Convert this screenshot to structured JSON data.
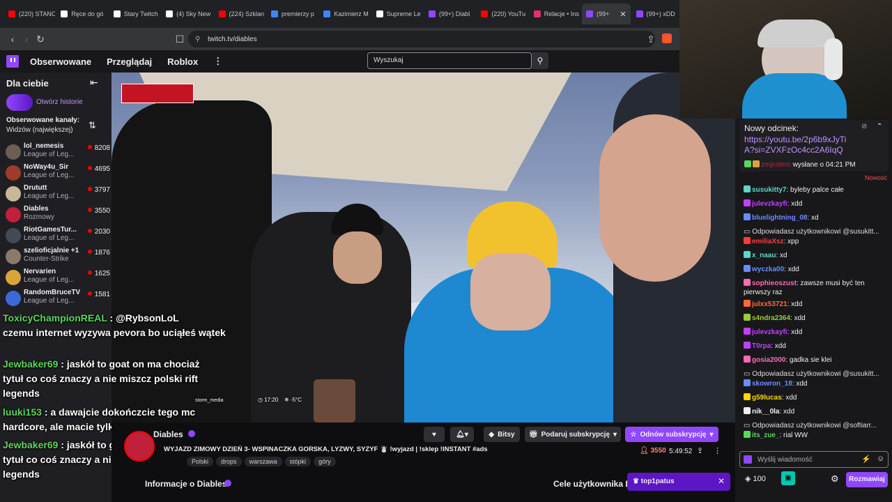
{
  "browser": {
    "tabs": [
      "(220) STANO",
      "Ręce do gó",
      "Stary Twitch",
      "(4) Sky New",
      "(224) Szklan",
      "premierzy p",
      "Kazimierz M",
      "Supreme Le",
      "(99+) Diabl",
      "(220) YouTu",
      "Relacje • Ins",
      "(99+",
      "(99+) xDD"
    ],
    "tab_colors": [
      "#ff0000",
      "#ffffff",
      "#ffffff",
      "#ffffff",
      "#ff0000",
      "#4285f4",
      "#4285f4",
      "#ffffff",
      "#9147ff",
      "#ff0000",
      "#e1306c",
      "#9147ff",
      "#9147ff"
    ],
    "url": "twitch.tv/diables"
  },
  "nav": {
    "links": [
      "Obserwowane",
      "Przeglądaj",
      "Roblox"
    ],
    "more": "⋮",
    "search_placeholder": "Wyszukaj"
  },
  "sidebar": {
    "title": "Dla ciebie",
    "stories_link": "Otwórz historie",
    "followed_title": "Obserwowane kanały:",
    "followed_sort": "Widzów (największej)",
    "channels": [
      {
        "name": "lol_nemesis",
        "game": "League of Leg...",
        "viewers": "8208",
        "color": "#6b5f55"
      },
      {
        "name": "NoWay4u_Sir",
        "game": "League of Leg...",
        "viewers": "4695",
        "color": "#a03a2a"
      },
      {
        "name": "Drututt",
        "game": "League of Leg...",
        "viewers": "3797",
        "color": "#c9b79a"
      },
      {
        "name": "Diables",
        "game": "Rozmowy",
        "viewers": "3550",
        "color": "#c0203a"
      },
      {
        "name": "RiotGamesTur...",
        "game": "League of Leg...",
        "viewers": "2030",
        "color": "#444a55"
      },
      {
        "name": "szelioficjalnie +1",
        "game": "Counter-Strike",
        "viewers": "1876",
        "color": "#8a7a6a"
      },
      {
        "name": "Nervarien",
        "game": "League of Leg...",
        "viewers": "1625",
        "color": "#d9a43a"
      },
      {
        "name": "RandomBruceTV",
        "game": "League of Leg...",
        "viewers": "1581",
        "color": "#3a6ad9"
      }
    ]
  },
  "video_overlay": {
    "lines": [
      {
        "user": "ToxicyChampionREAL",
        "text": " : @RybsonLoL"
      },
      {
        "user": "",
        "text": "czemu internet wyzywa pevora bo uciąłeś wątek"
      },
      {
        "user": "Jewbaker69",
        "text": " : jaskół to goat on ma chociaż"
      },
      {
        "user": "",
        "text": "tytuł co coś znaczy a nie miszcz polski rift"
      },
      {
        "user": "",
        "text": "legends"
      },
      {
        "user": "luuki153",
        "text": " : a dawajcie dokończcie tego mc"
      },
      {
        "user": "",
        "text": "hardcore, ale macie tylko jedno podejście"
      },
      {
        "user": "Jewbaker69",
        "text": " : jaskół to goat on ma chociaż"
      },
      {
        "user": "",
        "text": "tytuł co coś znaczy a nie miszcz polski rift"
      },
      {
        "user": "",
        "text": "legends"
      }
    ],
    "storm": "storm_media",
    "time": "17:20",
    "temp": "-5°C"
  },
  "stream_info": {
    "channel": "Diables",
    "title": "WYJAZD ZIMOWY DZIEŃ 3- WSPINACZKA GORSKA, LYZWY, SYZYF ☃️ !wyjazd | !sklep !INSTANT #ads",
    "tags": [
      "Polski",
      "drops",
      "warszawa",
      "stópki",
      "góry"
    ],
    "viewers": "3550",
    "uptime": "5:49:52",
    "bits_label": "Bitsy",
    "gift_label": "Podaruj subskrypcję",
    "renew_label": "Odnów subskrypcję",
    "about": "Informacje o Diables",
    "goals": "Cele użytkownika D",
    "toast_user": "top1patus"
  },
  "chat": {
    "pinned_title": "Nowy odcinek:",
    "pinned_link": "https://youtu.be/2p6b9xJyTiA?si=ZVXFzOc4cc2A6IqQ",
    "pinned_by": "zmjestem",
    "pinned_sent": "wysłane o 04:21 PM",
    "new_label": "Nowość",
    "messages": [
      {
        "user": "susukitty7",
        "color": "#5ad8c8",
        "text": ": byleby palce całe"
      },
      {
        "user": "julevzkayfi",
        "color": "#c040ff",
        "text": ": xdd"
      },
      {
        "user": "bluelightning_08",
        "color": "#6a8cff",
        "text": ": xd"
      },
      {
        "reply": "Odpowiadasz użytkownikowi @susukitt..."
      },
      {
        "user": "emiliaXsz",
        "color": "#ff3b3b",
        "text": ": xpp"
      },
      {
        "user": "x_naau",
        "color": "#5ad8c8",
        "text": ": xd"
      },
      {
        "user": "wyczka00",
        "color": "#6a8cff",
        "text": ": xdd"
      },
      {
        "user": "sophieoszust",
        "color": "#ff69b4",
        "text": ": zawsze musi być ten pierwszy raz"
      },
      {
        "user": "julxx53721",
        "color": "#ff6a3a",
        "text": ": xdd"
      },
      {
        "user": "s4ndra2364",
        "color": "#9acd32",
        "text": ": xdd"
      },
      {
        "user": "julevzkayfi",
        "color": "#c040ff",
        "text": ": xdd"
      },
      {
        "user": "T0rpa",
        "color": "#c040ff",
        "text": ": xdd"
      },
      {
        "user": "gosia2000",
        "color": "#ff69b4",
        "text": ": gadka sie klei"
      },
      {
        "reply": "Odpowiadasz użytkownikowi @susukitt..."
      },
      {
        "user": "skowron_18",
        "color": "#6a8cff",
        "text": ": xdd"
      },
      {
        "user": "g59lucas",
        "color": "#ffd700",
        "text": ": xdd"
      },
      {
        "user": "nik__0la",
        "color": "#efeff1",
        "text": ": xdd"
      },
      {
        "reply": "Odpowiadasz użytkownikowi @softiarr..."
      },
      {
        "user": "its_zue_",
        "color": "#5ad85a",
        "text": ": rial WW"
      }
    ],
    "input_placeholder": "Wyślij wiadomość",
    "points": "100",
    "chat_button": "Rozmawiaj"
  }
}
